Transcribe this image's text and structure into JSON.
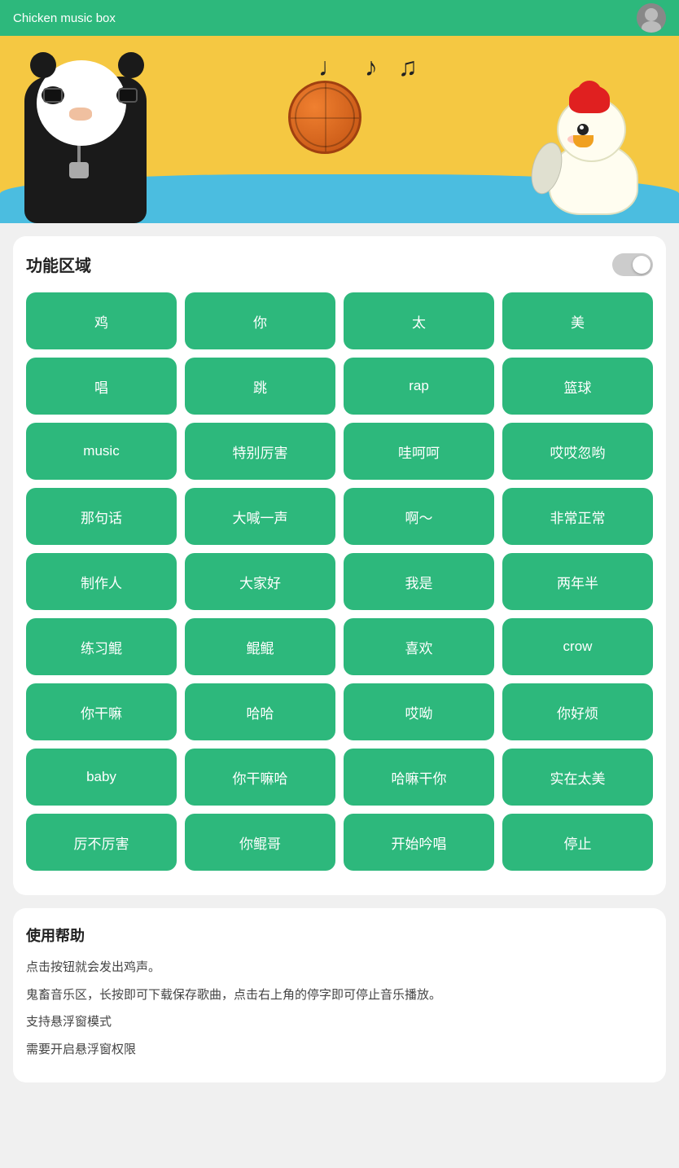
{
  "header": {
    "title": "Chicken music box",
    "avatar_label": "user avatar"
  },
  "section": {
    "title": "功能区域",
    "toggle_label": "toggle"
  },
  "buttons": [
    "鸡",
    "你",
    "太",
    "美",
    "唱",
    "跳",
    "rap",
    "篮球",
    "music",
    "特别厉害",
    "哇呵呵",
    "哎哎忽哟",
    "那句话",
    "大喊一声",
    "啊～",
    "非常正常",
    "制作人",
    "大家好",
    "我是",
    "两年半",
    "练习鲲",
    "鲲鲲",
    "喜欢",
    "crow",
    "你干嘛",
    "哈哈",
    "哎呦",
    "你好烦",
    "baby",
    "你干嘛哈",
    "哈嘛干你",
    "实在太美",
    "厉不厉害",
    "你鲲哥",
    "开始吟唱",
    "停止"
  ],
  "help": {
    "title": "使用帮助",
    "lines": [
      "点击按钮就会发出鸡声。",
      "鬼畜音乐区，长按即可下载保存歌曲，点击右上角的停字即可停止音乐播放。",
      "支持悬浮窗模式",
      "需要开启悬浮窗权限"
    ]
  }
}
